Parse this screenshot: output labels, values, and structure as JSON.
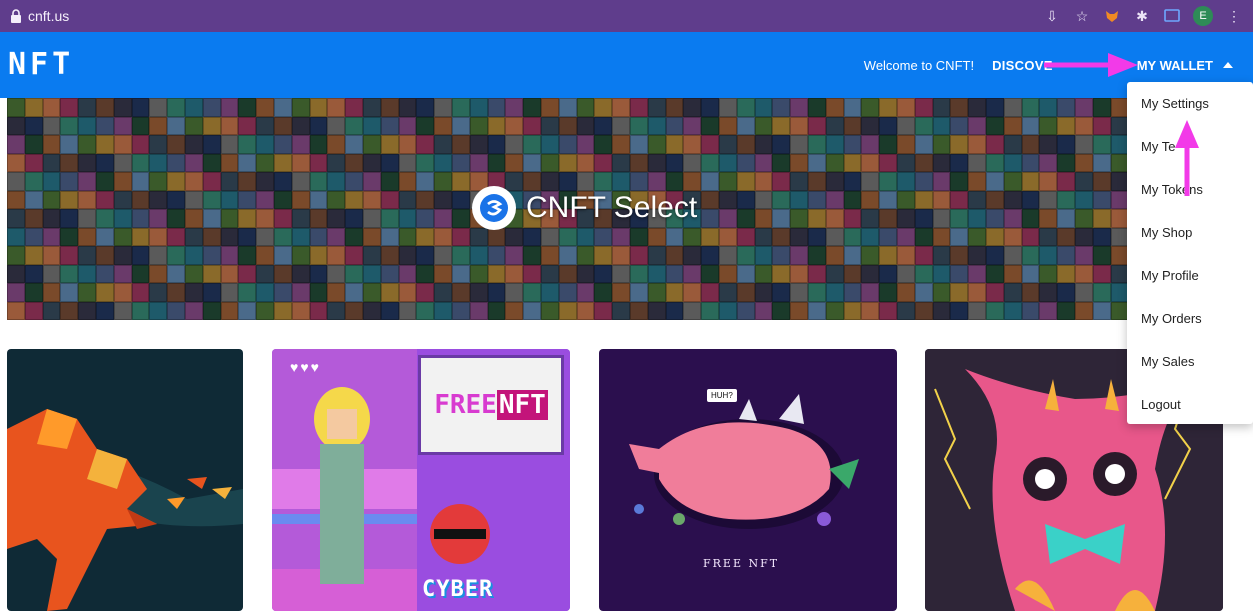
{
  "browser": {
    "url": "cnft.us",
    "profile_initial": "E"
  },
  "nav": {
    "logo": "NFT",
    "welcome": "Welcome to CNFT!",
    "discover": "DISCOVE",
    "wallet": "MY WALLET"
  },
  "hero": {
    "title": "CNFT Select"
  },
  "cards": {
    "card2_free": "FREE",
    "card2_nft": "NFT",
    "card2_cyber": "CYBER",
    "card3_speech": "HUH?",
    "card3_caption": "FREE NFT"
  },
  "dropdown": {
    "items": [
      {
        "label": "My Settings"
      },
      {
        "label": "My Te"
      },
      {
        "label": "My Tokens"
      },
      {
        "label": "My Shop"
      },
      {
        "label": "My Profile"
      },
      {
        "label": "My Orders"
      },
      {
        "label": "My Sales"
      },
      {
        "label": "Logout"
      }
    ]
  },
  "colors": {
    "nav_blue": "#0a7bf0",
    "browser_purple": "#5f3d8c",
    "annotation_arrow": "#f23ae8"
  },
  "icons": [
    "lock-icon",
    "install-icon",
    "star-icon",
    "fox-extension-icon",
    "puzzle-extension-icon",
    "cast-icon",
    "kebab-menu-icon",
    "caret-up-icon",
    "cnft-logo-icon",
    "annotation-arrow-icon"
  ]
}
